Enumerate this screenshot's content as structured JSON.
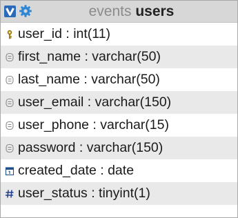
{
  "header": {
    "database": "events",
    "table": "users"
  },
  "icons": {
    "toggle": "toggle-v-icon",
    "settings": "gear-icon"
  },
  "colors": {
    "header_bg": "#d7d7d7",
    "alt_row_bg": "#e9e9e9",
    "accent": "#2a6ab8"
  },
  "columns": [
    {
      "label": "user_id : int(11)",
      "icon": "primary-key-icon"
    },
    {
      "label": "first_name : varchar(50)",
      "icon": "text-field-icon"
    },
    {
      "label": "last_name : varchar(50)",
      "icon": "text-field-icon"
    },
    {
      "label": "user_email : varchar(150)",
      "icon": "text-field-icon"
    },
    {
      "label": "user_phone : varchar(15)",
      "icon": "text-field-icon"
    },
    {
      "label": "password : varchar(150)",
      "icon": "text-field-icon"
    },
    {
      "label": "created_date : date",
      "icon": "date-field-icon"
    },
    {
      "label": "user_status : tinyint(1)",
      "icon": "numeric-field-icon"
    }
  ]
}
